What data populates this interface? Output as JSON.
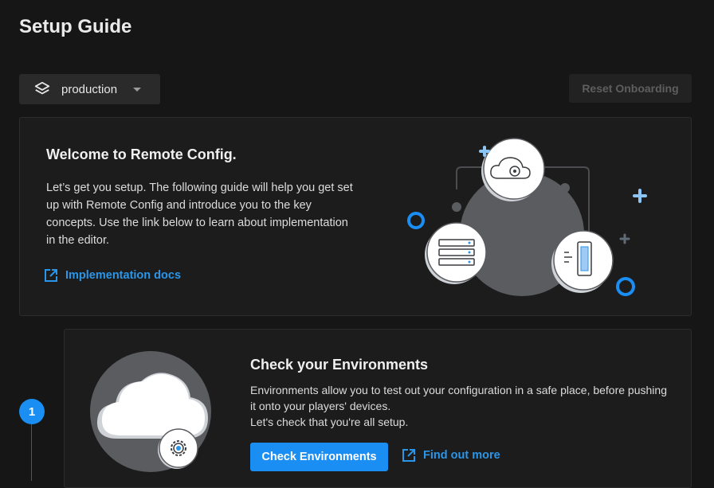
{
  "page": {
    "title": "Setup Guide"
  },
  "toolbar": {
    "environment": "production",
    "reset_label": "Reset Onboarding"
  },
  "welcome": {
    "title": "Welcome to Remote Config.",
    "body": "Let’s get you setup. The following guide will help you get set up with Remote Config and introduce you to the key concepts. Use the link below to learn about implementation in the editor.",
    "link_label": "Implementation docs"
  },
  "step": {
    "number": "1",
    "title": "Check your Environments",
    "body_line1": "Environments allow you to test out your configuration in a safe place, before pushing it onto your players' devices.",
    "body_line2": "Let's check that you're all setup.",
    "button_label": "Check Environments",
    "link_label": "Find out more"
  },
  "icons": {
    "env_select": "layers-icon",
    "links": "external-link-icon"
  },
  "colors": {
    "accent": "#1a8ef2",
    "background": "#161616",
    "card": "#1c1c1c"
  }
}
